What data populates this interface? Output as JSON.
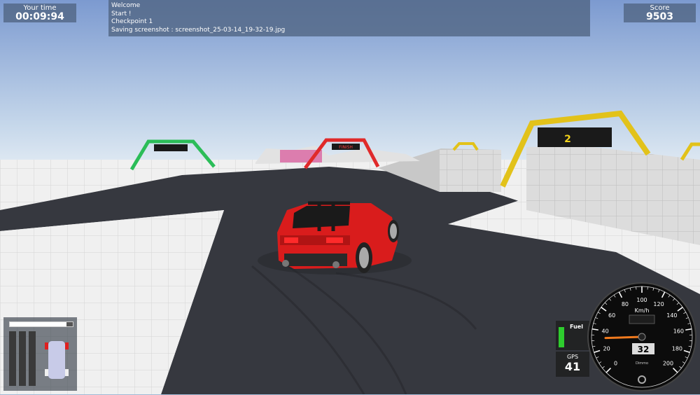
{
  "hud": {
    "time_label": "Your time",
    "time_value": "00:09:94",
    "score_label": "Score",
    "score_value": "9503",
    "log": [
      "Welcome",
      "Start !",
      "Checkpoint 1",
      "Saving screenshot : screenshot_25-03-14_19-32-19.jpg"
    ]
  },
  "world": {
    "finish_label": "FINISH",
    "checkpoint_number": "2"
  },
  "fuel": {
    "label": "Fuel",
    "level": 0.85,
    "color": "#2ecc2e"
  },
  "gps": {
    "label": "GPS",
    "value": "41"
  },
  "speedometer": {
    "unit": "Km/h",
    "brand": "Dimmo",
    "speed_readout": "32",
    "needle_speed": 32,
    "ticks": [
      "0",
      "20",
      "40",
      "60",
      "80",
      "100",
      "120",
      "140",
      "160",
      "180",
      "200"
    ],
    "needle_color": "#f07a1e"
  },
  "minimap": {
    "throttle_level": 0.9
  }
}
